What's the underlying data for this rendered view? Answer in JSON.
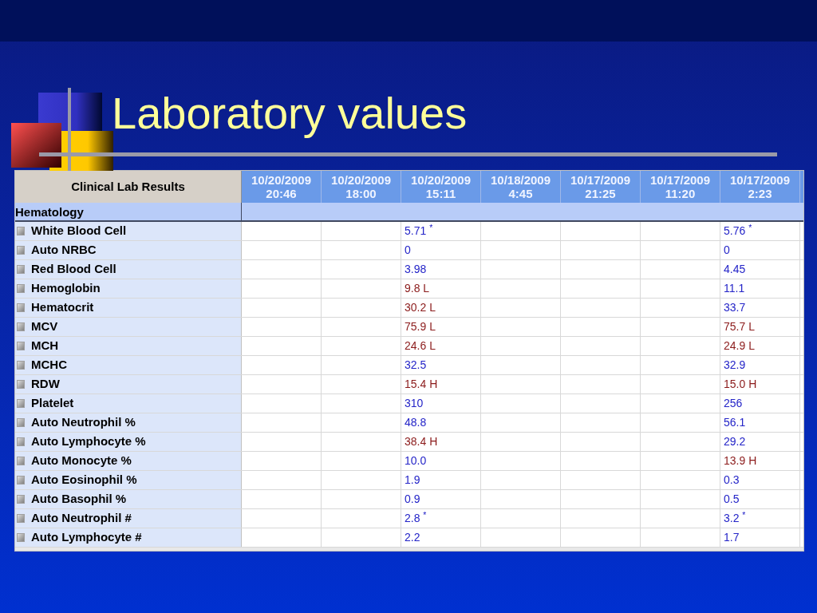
{
  "slide": {
    "title": "Laboratory values"
  },
  "table": {
    "header": "Clinical Lab Results",
    "columns": [
      {
        "date": "10/20/2009",
        "time": "20:46"
      },
      {
        "date": "10/20/2009",
        "time": "18:00"
      },
      {
        "date": "10/20/2009",
        "time": "15:11"
      },
      {
        "date": "10/18/2009",
        "time": "4:45"
      },
      {
        "date": "10/17/2009",
        "time": "21:25"
      },
      {
        "date": "10/17/2009",
        "time": "11:20"
      },
      {
        "date": "10/17/2009",
        "time": "2:23"
      }
    ],
    "section": "Hematology",
    "rows": [
      {
        "name": "White Blood Cell",
        "column_3": {
          "text": "5.71 $^{*}$",
          "abnormal": false
        },
        "column_7": {
          "text": "5.76 $^{*}$",
          "abnormal": false
        }
      },
      {
        "name": "Auto NRBC",
        "column_3": {
          "text": "0",
          "abnormal": false
        },
        "column_7": {
          "text": "0",
          "abnormal": false
        }
      },
      {
        "name": "Red Blood Cell",
        "column_3": {
          "text": "3.98",
          "abnormal": false
        },
        "column_7": {
          "text": "4.45",
          "abnormal": false
        }
      },
      {
        "name": "Hemoglobin",
        "column_3": {
          "text": "9.8 L",
          "abnormal": true
        },
        "column_7": {
          "text": "11.1",
          "abnormal": false
        }
      },
      {
        "name": "Hematocrit",
        "column_3": {
          "text": "30.2 L",
          "abnormal": true
        },
        "column_7": {
          "text": "33.7",
          "abnormal": false
        }
      },
      {
        "name": "MCV",
        "column_3": {
          "text": "75.9 L",
          "abnormal": true
        },
        "column_7": {
          "text": "75.7 L",
          "abnormal": true
        }
      },
      {
        "name": "MCH",
        "column_3": {
          "text": "24.6 L",
          "abnormal": true
        },
        "column_7": {
          "text": "24.9 L",
          "abnormal": true
        }
      },
      {
        "name": "MCHC",
        "column_3": {
          "text": "32.5",
          "abnormal": false
        },
        "column_7": {
          "text": "32.9",
          "abnormal": false
        }
      },
      {
        "name": "RDW",
        "column_3": {
          "text": "15.4 H",
          "abnormal": true
        },
        "column_7": {
          "text": "15.0 H",
          "abnormal": true
        }
      },
      {
        "name": "Platelet",
        "column_3": {
          "text": "310",
          "abnormal": false
        },
        "column_7": {
          "text": "256",
          "abnormal": false
        }
      },
      {
        "name": "Auto Neutrophil %",
        "column_3": {
          "text": "48.8",
          "abnormal": false
        },
        "column_7": {
          "text": "56.1",
          "abnormal": false
        }
      },
      {
        "name": "Auto Lymphocyte %",
        "column_3": {
          "text": "38.4 H",
          "abnormal": true
        },
        "column_7": {
          "text": "29.2",
          "abnormal": false
        }
      },
      {
        "name": "Auto Monocyte %",
        "column_3": {
          "text": "10.0",
          "abnormal": false
        },
        "column_7": {
          "text": "13.9 H",
          "abnormal": true
        }
      },
      {
        "name": "Auto Eosinophil %",
        "column_3": {
          "text": "1.9",
          "abnormal": false
        },
        "column_7": {
          "text": "0.3",
          "abnormal": false
        }
      },
      {
        "name": "Auto Basophil %",
        "column_3": {
          "text": "0.9",
          "abnormal": false
        },
        "column_7": {
          "text": "0.5",
          "abnormal": false
        }
      },
      {
        "name": "Auto Neutrophil #",
        "column_3": {
          "text": "2.8 $^{*}$",
          "abnormal": false
        },
        "column_7": {
          "text": "3.2 $^{*}$",
          "abnormal": false
        }
      },
      {
        "name": "Auto Lymphocyte #",
        "column_3": {
          "text": "2.2",
          "abnormal": false
        },
        "column_7": {
          "text": "1.7",
          "abnormal": false
        }
      }
    ]
  }
}
